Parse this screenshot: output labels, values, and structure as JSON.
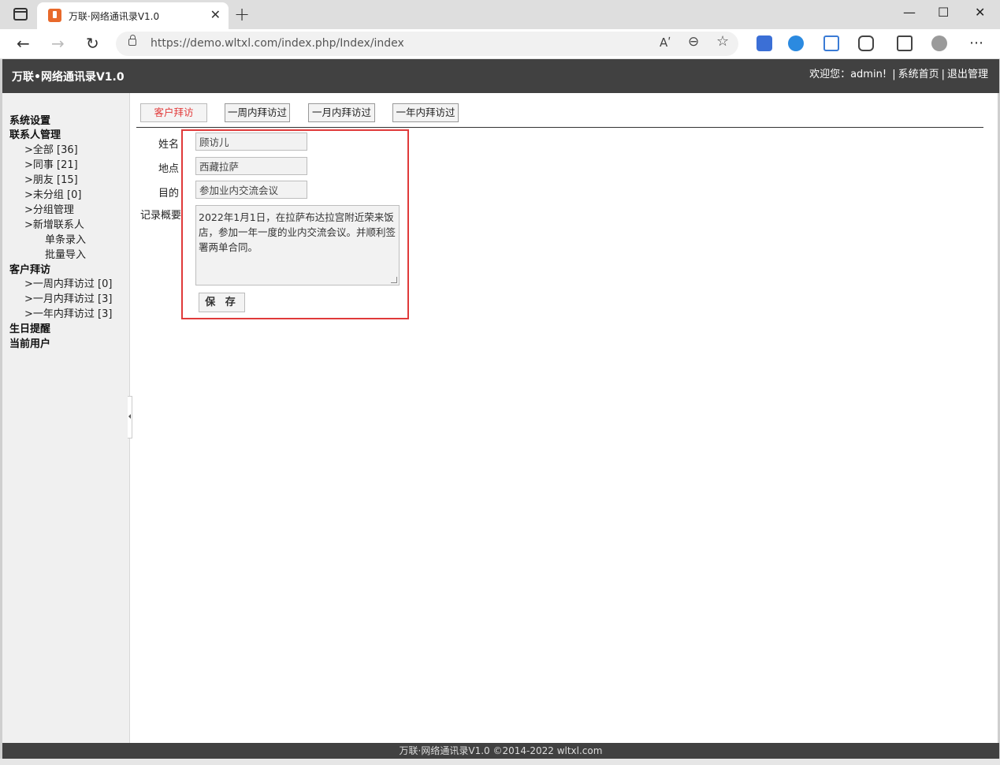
{
  "browser": {
    "tab_title": "万联·网络通讯录V1.0",
    "tab_close": "✕",
    "new_tab": "+",
    "url": "https://demo.wltxl.com/index.php/Index/index",
    "min_btn": "—",
    "max_btn": "☐",
    "close_btn": "✕",
    "back": "←",
    "forward": "→",
    "reload": "↻",
    "read_aloud": "Aʹ",
    "zoom": "⊖",
    "favorite": "☆",
    "more": "⋯"
  },
  "header": {
    "title": "万联•网络通讯录V1.0",
    "welcome": "欢迎您：admin!",
    "sep1": "|",
    "home_link": "系统首页",
    "sep2": "|",
    "logout_link": "退出管理"
  },
  "sidebar": {
    "system_settings": "系统设置",
    "contacts_mgmt": "联系人管理",
    "all": ">全部 [36]",
    "colleagues": ">同事 [21]",
    "friends": ">朋友 [15]",
    "ungrouped": ">未分组 [0]",
    "group_mgmt": ">分组管理",
    "add_contact": ">新增联系人",
    "single_entry": "单条录入",
    "batch_import": "批量导入",
    "customer_visits": "客户拜访",
    "visited_week": ">一周内拜访过 [0]",
    "visited_month": ">一月内拜访过 [3]",
    "visited_year": ">一年内拜访过 [3]",
    "birthday": "生日提醒",
    "current_user": "当前用户"
  },
  "tabs": {
    "customer_visit": "客户拜访",
    "week": "一周内拜访过",
    "month": "一月内拜访过",
    "year": "一年内拜访过"
  },
  "form": {
    "name_label": "姓名",
    "name_value": "顾访儿",
    "location_label": "地点",
    "location_value": "西藏拉萨",
    "purpose_label": "目的",
    "purpose_value": "参加业内交流会议",
    "summary_label": "记录概要",
    "summary_value": "2022年1月1日，在拉萨布达拉宫附近荣来饭店，参加一年一度的业内交流会议。并顺利签署两单合同。",
    "save_label": "保 存"
  },
  "footer": {
    "text": "万联·网络通讯录V1.0 ©2014-2022 wltxl.com"
  },
  "colors": {
    "header_bg": "#414141",
    "highlight_border": "#e03a3a",
    "active_tab_text": "#e23a3a"
  }
}
